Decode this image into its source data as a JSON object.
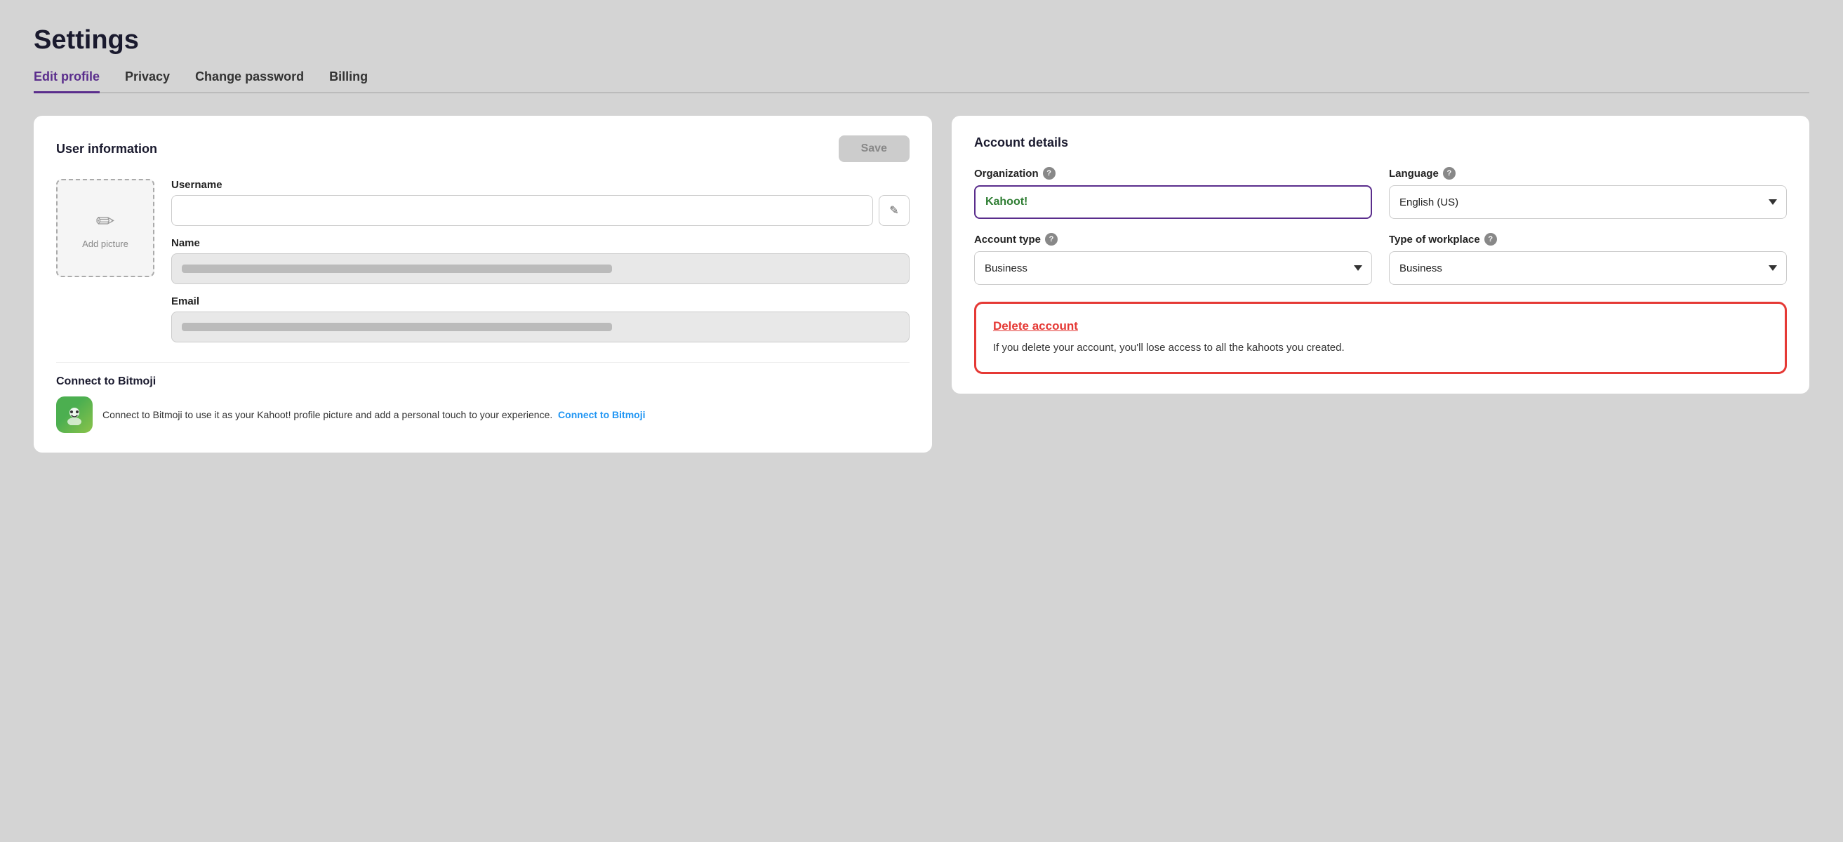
{
  "page": {
    "title": "Settings"
  },
  "tabs": [
    {
      "id": "edit-profile",
      "label": "Edit profile",
      "active": true
    },
    {
      "id": "privacy",
      "label": "Privacy",
      "active": false
    },
    {
      "id": "change-password",
      "label": "Change password",
      "active": false
    },
    {
      "id": "billing",
      "label": "Billing",
      "active": false
    }
  ],
  "left_card": {
    "title": "User information",
    "save_button": "Save",
    "avatar": {
      "label": "Add picture"
    },
    "fields": {
      "username_label": "Username",
      "username_value": "",
      "name_label": "Name",
      "name_value": "",
      "email_label": "Email",
      "email_value": ""
    },
    "connect_bitmoji": {
      "title": "Connect to Bitmoji",
      "description": "Connect to Bitmoji to use it as your Kahoot! profile picture and add a personal touch to your experience.",
      "link_text": "Connect to Bitmoji"
    }
  },
  "right_card": {
    "title": "Account details",
    "organization_label": "Organization",
    "organization_help": "?",
    "organization_value": "Kahoot!",
    "language_label": "Language",
    "language_help": "?",
    "language_value": "English (US)",
    "account_type_label": "Account type",
    "account_type_help": "?",
    "account_type_value": "Business",
    "workplace_label": "Type of workplace",
    "workplace_help": "?",
    "workplace_value": "Business",
    "delete_account": {
      "title": "Delete account",
      "description": "If you delete your account, you'll lose access to all the kahoots you created."
    }
  }
}
